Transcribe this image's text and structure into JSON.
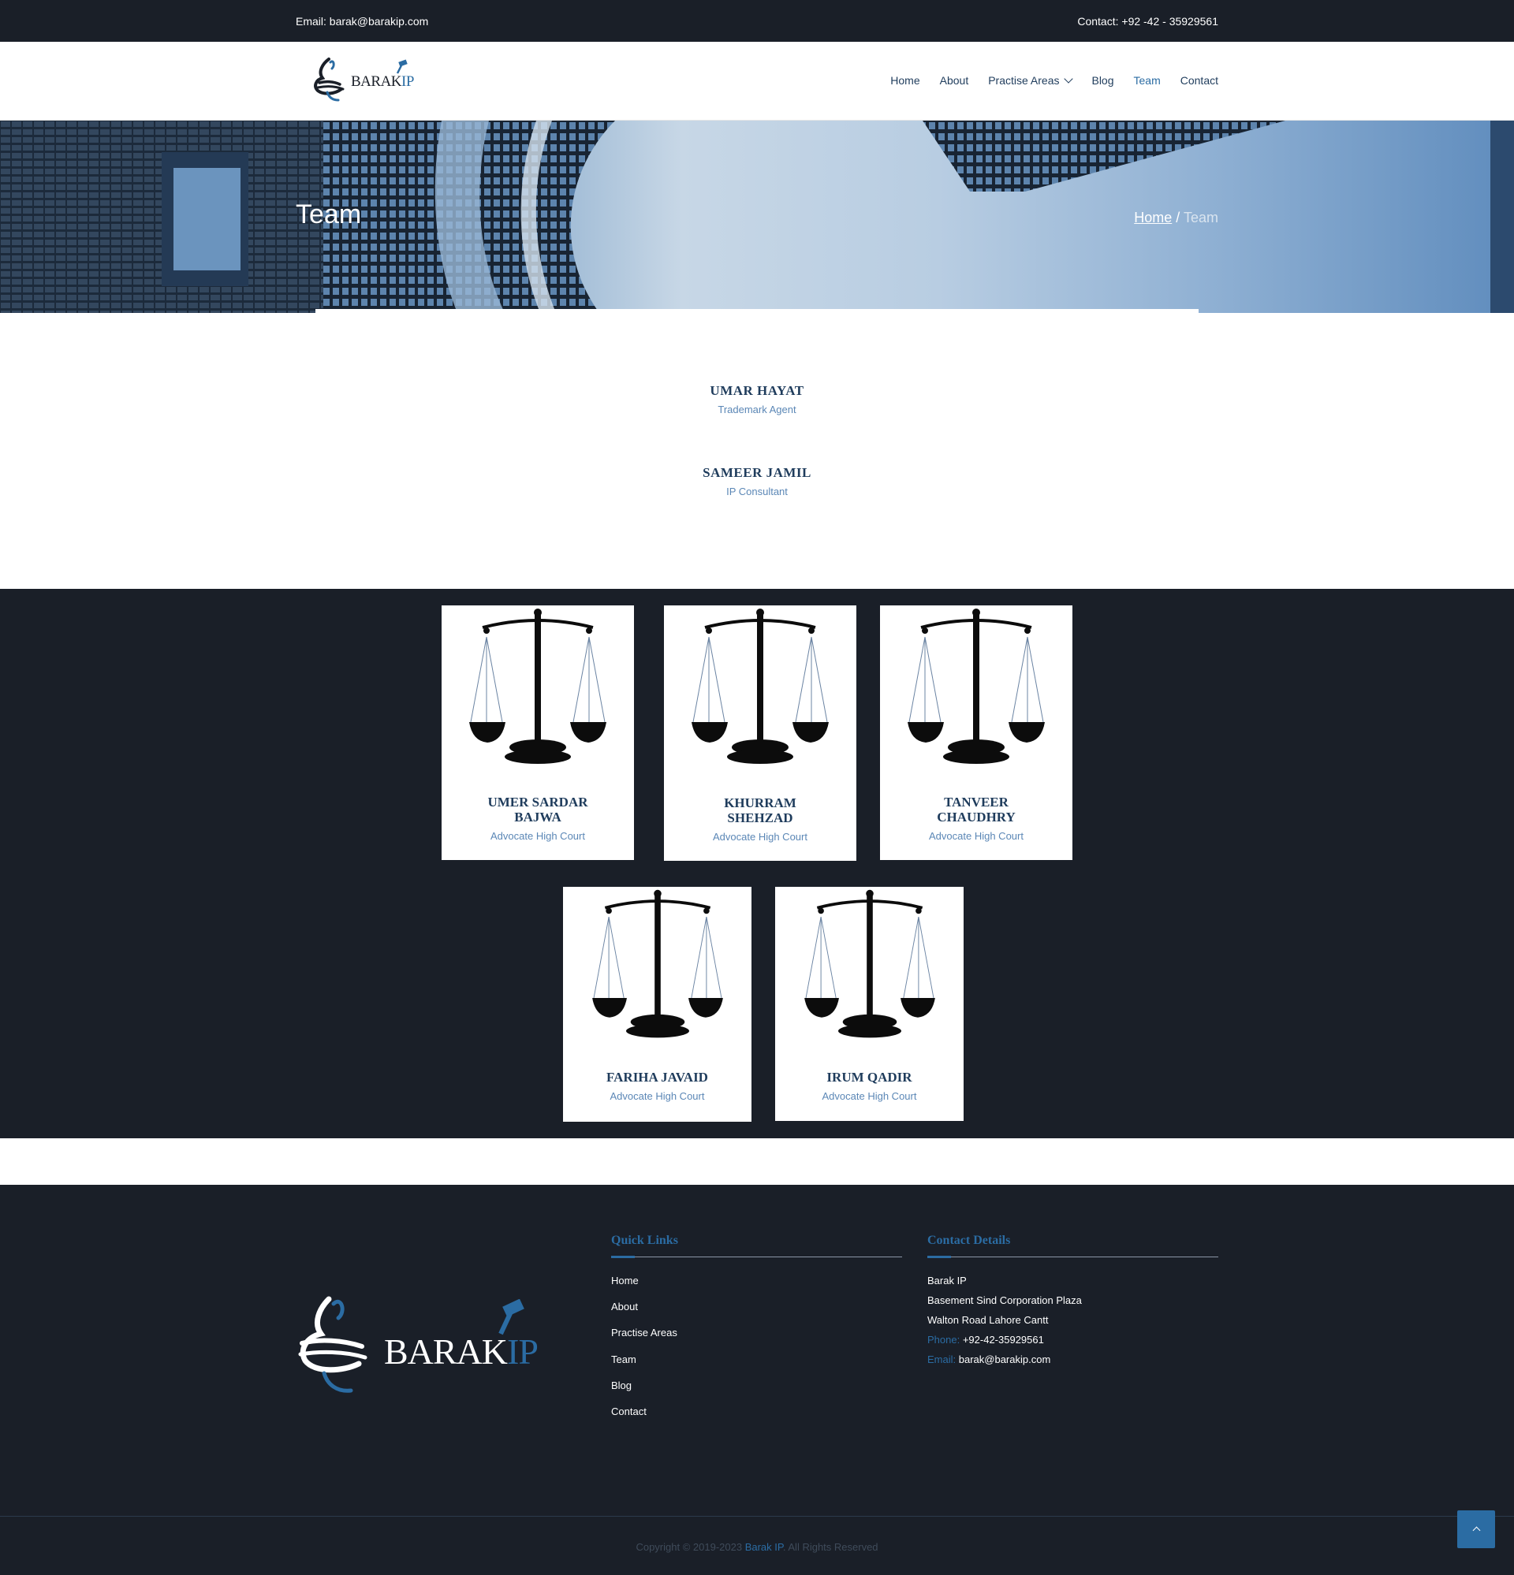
{
  "topbar": {
    "email": "Email: barak@barakip.com",
    "contact": "Contact:  +92 -42 - 35929561"
  },
  "header": {
    "logo": {
      "text": "BARAK",
      "suffix": "IP"
    },
    "nav": [
      {
        "label": "Home"
      },
      {
        "label": "About"
      },
      {
        "label": "Practise Areas"
      },
      {
        "label": "Blog"
      },
      {
        "label": "Team"
      },
      {
        "label": "Contact"
      }
    ]
  },
  "banner": {
    "title": "Team",
    "breadcrumb": {
      "home": "Home",
      "separator": "/",
      "current": "Team"
    }
  },
  "featured_members": [
    {
      "name": "UMAR HAYAT",
      "role": "Trademark Agent"
    },
    {
      "name": "SAMEER JAMIL",
      "role": "IP Consultant"
    }
  ],
  "team_cards": [
    {
      "name_line1": "UMER SARDAR",
      "name_line2": "BAJWA",
      "role": "Advocate High Court"
    },
    {
      "name_line1": "KHURRAM",
      "name_line2": "SHEHZAD",
      "role": "Advocate High Court"
    },
    {
      "name_line1": "TANVEER",
      "name_line2": "CHAUDHRY",
      "role": "Advocate High Court"
    },
    {
      "name_line1": "FARIHA JAVAID",
      "name_line2": "",
      "role": "Advocate High Court"
    },
    {
      "name_line1": "IRUM QADIR",
      "name_line2": "",
      "role": "Advocate High Court"
    }
  ],
  "footer": {
    "logo": {
      "text": "BARAK",
      "suffix": "IP"
    },
    "quick_links_title": "Quick Links",
    "quick_links": [
      "Home",
      "About",
      "Practise Areas",
      "Team",
      "Blog",
      "Contact"
    ],
    "contact_title": "Contact Details",
    "contact": {
      "company": "Barak IP",
      "address1": "Basement Sind Corporation Plaza",
      "address2": "Walton Road Lahore Cantt",
      "phone_label": "Phone:",
      "phone": "+92-42-35929561",
      "email_label": "Email:",
      "email": "barak@barakip.com"
    },
    "copyright_prefix": "Copyright © 2019-2023",
    "copyright_brand": "Barak IP",
    "copyright_suffix": ". All Rights Reserved"
  },
  "colors": {
    "dark": "#1a1f28",
    "accent": "#2b6ca3",
    "heading": "#1f3c5c",
    "muted": "#5b87b6"
  },
  "icons": {
    "card_image": "scales-of-justice-icon",
    "nav_dropdown": "chevron-down-icon",
    "back_to_top": "chevron-up-icon"
  }
}
